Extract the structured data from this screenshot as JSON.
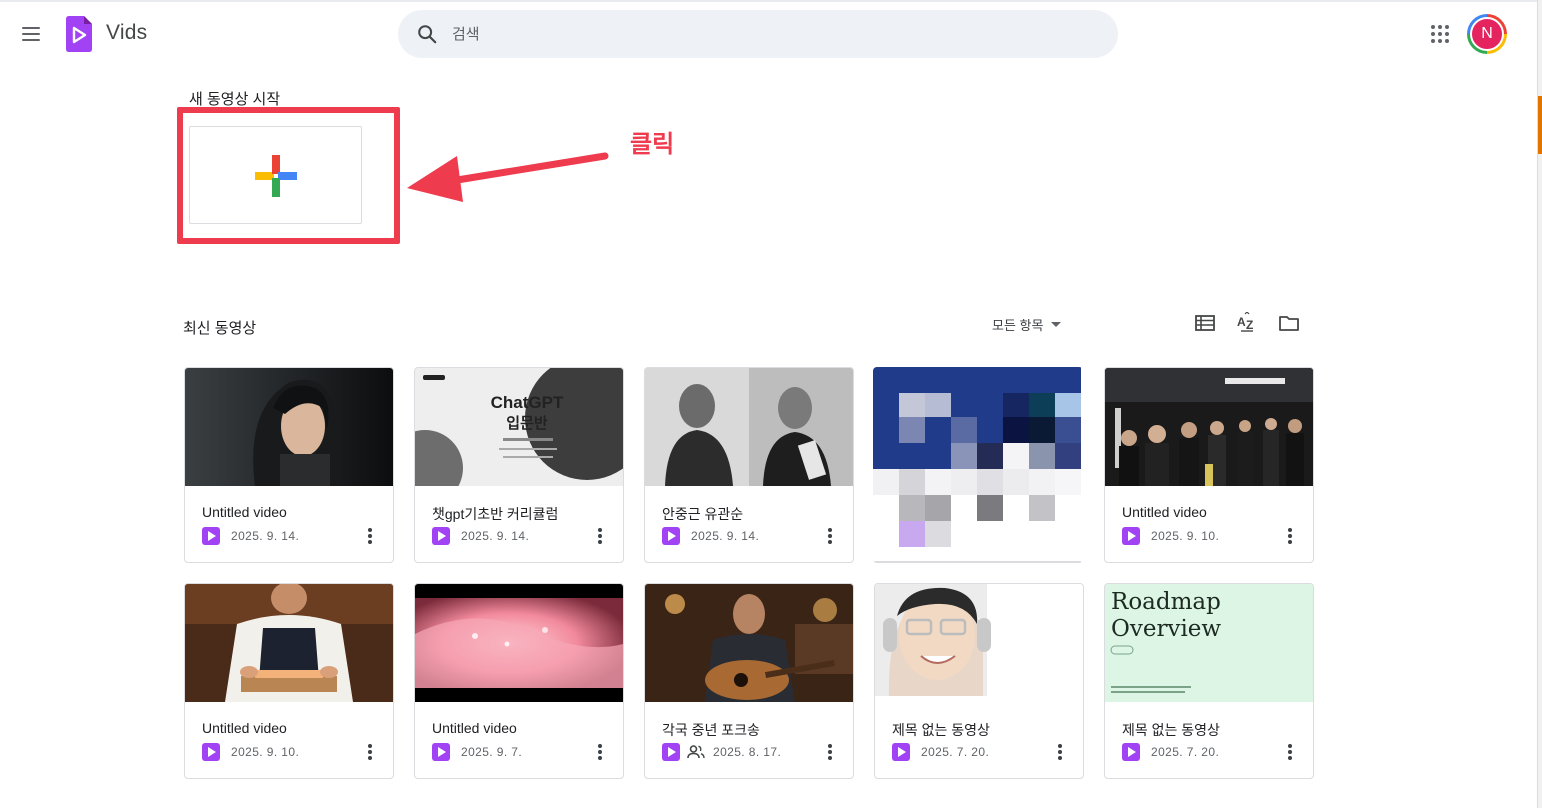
{
  "app": {
    "name": "Vids"
  },
  "search": {
    "placeholder": "검색"
  },
  "account": {
    "initial": "N"
  },
  "new_video": {
    "section_title": "새 동영상 시작"
  },
  "annotation": {
    "label": "클릭",
    "color": "#ee3b4e"
  },
  "recent": {
    "section_title": "최신 동영상",
    "filter_label": "모든 항목"
  },
  "icons": {
    "menu": "hamburger-menu-icon",
    "logo": "vids-logo-icon",
    "search": "search-icon",
    "apps": "apps-grid-icon",
    "list_view": "list-view-icon",
    "sort": "sort-az-icon",
    "folder": "folder-icon",
    "video": "vids-file-icon",
    "shared": "shared-people-icon",
    "more": "more-vert-icon"
  },
  "colors": {
    "brand_purple": "#a142f4",
    "highlight_red": "#ee3b4e",
    "avatar_bg": "#e4235f"
  },
  "videos": [
    {
      "title": "Untitled video",
      "date": "2025. 9. 14.",
      "shared": false
    },
    {
      "title": "챗gpt기초반 커리큘럼",
      "date": "2025. 9. 14.",
      "shared": false,
      "thumb_title": "ChatGPT\n입문반"
    },
    {
      "title": "안중근 유관순",
      "date": "2025. 9. 14.",
      "shared": false
    },
    {
      "title": "",
      "date": "",
      "shared": false
    },
    {
      "title": "Untitled video",
      "date": "2025. 9. 10.",
      "shared": false
    },
    {
      "title": "Untitled video",
      "date": "2025. 9. 10.",
      "shared": false
    },
    {
      "title": "Untitled video",
      "date": "2025. 9. 7.",
      "shared": false
    },
    {
      "title": "각국 중년 포크송",
      "date": "2025. 8. 17.",
      "shared": true
    },
    {
      "title": "제목 없는 동영상",
      "date": "2025. 7. 20.",
      "shared": false
    },
    {
      "title": "제목 없는 동영상",
      "date": "2025. 7. 20.",
      "shared": false,
      "thumb_title": "Roadmap\nOverview"
    }
  ]
}
